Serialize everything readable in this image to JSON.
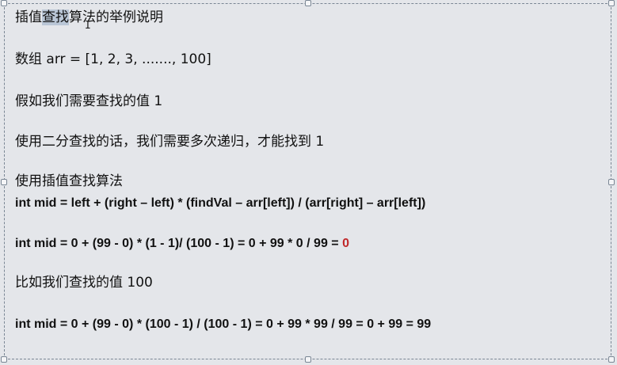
{
  "slide": {
    "line1": {
      "before": "插值",
      "selected": "查找",
      "after": "算法的举例说明"
    },
    "line2": "数组 arr = [1, 2, 3, ......., 100]",
    "line3": "假如我们需要查找的值 1",
    "line4": "使用二分查找的话，我们需要多次递归，才能找到 1",
    "line5": "使用插值查找算法",
    "line6": "int mid = left + (right – left) * (findVal – arr[left]) / (arr[right] – arr[left])",
    "line7": {
      "text": "int mid = 0 + (99 - 0) * (1 - 1)/ (100 - 1) = 0 + 99 * 0 / 99 = ",
      "result": "0"
    },
    "line8": "比如我们查找的值 100",
    "line9": "int mid = 0 + (99 - 0) * (100 - 1) / (100 - 1) = 0 + 99 * 99 / 99 = 0 + 99 = 99"
  },
  "colors": {
    "result_red": "#c0282a",
    "selection": "#b9c6d6",
    "border": "#7a8694"
  }
}
